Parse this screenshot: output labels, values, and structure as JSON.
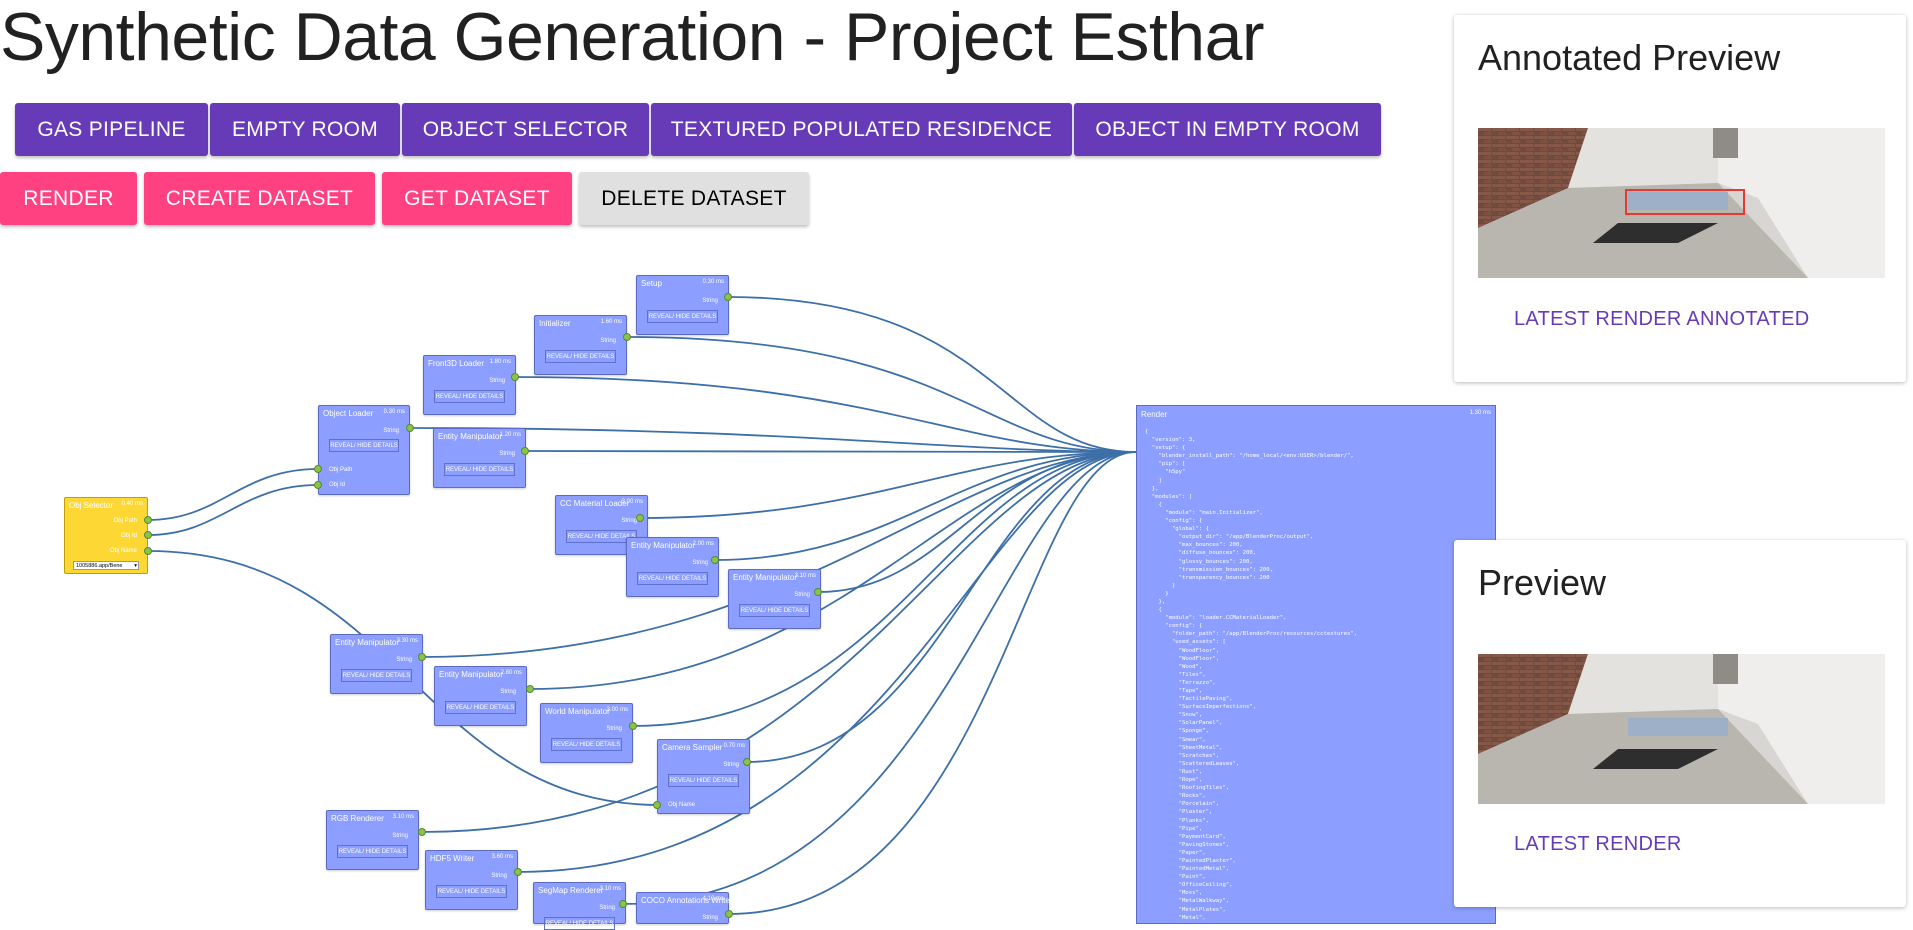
{
  "page_title": "Synthetic Data Generation - Project Esthar",
  "scene_buttons": [
    "GAS PIPELINE",
    "EMPTY ROOM",
    "OBJECT SELECTOR",
    "TEXTURED POPULATED RESIDENCE",
    "OBJECT IN EMPTY ROOM"
  ],
  "action_buttons": {
    "render": "RENDER",
    "create": "CREATE DATASET",
    "get": "GET DATASET",
    "delete": "DELETE DATASET"
  },
  "annotated_card": {
    "title": "Annotated Preview",
    "link": "LATEST RENDER ANNOTATED"
  },
  "preview_card": {
    "title": "Preview",
    "link": "LATEST RENDER"
  },
  "node_button_label": "REVEAL/ HIDE DETAILS",
  "nodes": [
    {
      "title": "Setup",
      "ms": "0.30 ms",
      "out": "String"
    },
    {
      "title": "Initializer",
      "ms": "1.60 ms",
      "out": "String"
    },
    {
      "title": "Front3D Loader",
      "ms": "1.80 ms",
      "out": "String"
    },
    {
      "title": "Object Loader",
      "ms": "0.30 ms",
      "out": "String",
      "in1": "Obj Path",
      "in2": "Obj Id"
    },
    {
      "title": "Entity Manipulator",
      "ms": "1.20 ms",
      "out": "String"
    },
    {
      "title": "CC Material Loader",
      "ms": "3.00 ms",
      "out": "String"
    },
    {
      "title": "Entity Manipulator",
      "ms": "2.00 ms",
      "out": "String"
    },
    {
      "title": "Entity Manipulator",
      "ms": "3.10 ms",
      "out": "String"
    },
    {
      "title": "Entity Manipulator",
      "ms": "3.30 ms",
      "out": "String"
    },
    {
      "title": "Entity Manipulator",
      "ms": "2.80 ms",
      "out": "String"
    },
    {
      "title": "World Manipulator",
      "ms": "3.00 ms",
      "out": "String"
    },
    {
      "title": "Camera Sampler",
      "ms": "0.70 ms",
      "out": "String",
      "in1": "Obj Name"
    },
    {
      "title": "RGB Renderer",
      "ms": "3.10 ms",
      "out": "String"
    },
    {
      "title": "HDF5 Writer",
      "ms": "3.60 ms",
      "out": "String"
    },
    {
      "title": "SegMap Renderer",
      "ms": "3.10 ms",
      "out": "String"
    },
    {
      "title": "COCO Annotations Writer",
      "ms": "4.10 ms",
      "out": "String"
    }
  ],
  "obj_selector": {
    "title": "Obj Selector",
    "ms": "0.40 ms",
    "out1": "Obj Path",
    "out2": "Obj Id",
    "out3": "Obj Name",
    "select_value": "1005886.app/Bene"
  },
  "render_node": {
    "title": "Render",
    "ms": "1.30 ms",
    "json": "{\n  \"version\": 3,\n  \"setup\": {\n    \"blender_install_path\": \"/home_local/<env:USER>/blender/\",\n    \"pip\": [\n      \"h5py\"\n    ]\n  },\n  \"modules\": [\n    {\n      \"module\": \"main.Initializer\",\n      \"config\": {\n        \"global\": {\n          \"output_dir\": \"/app/BlenderProc/output\",\n          \"max_bounces\": 200,\n          \"diffuse_bounces\": 200,\n          \"glossy_bounces\": 200,\n          \"transmission_bounces\": 200,\n          \"transparency_bounces\": 200\n        }\n      }\n    },\n    {\n      \"module\": \"loader.CCMaterialLoader\",\n      \"config\": {\n        \"folder_path\": \"/app/BlenderProc/resources/cctextures\",\n        \"used_assets\": [\n          \"WoodFloor\",\n          \"WoodFloor\",\n          \"Wood\",\n          \"Tiles\",\n          \"Terrazzo\",\n          \"Tape\",\n          \"TactilePaving\",\n          \"SurfaceImperfections\",\n          \"Snow\",\n          \"SolarPanel\",\n          \"Sponge\",\n          \"Smear\",\n          \"SheetMetal\",\n          \"Scratches\",\n          \"ScatteredLeaves\",\n          \"Rust\",\n          \"Rope\",\n          \"RoofingTiles\",\n          \"Rocks\",\n          \"Porcelain\",\n          \"Plaster\",\n          \"Planks\",\n          \"Pipe\",\n          \"PaymentCard\",\n          \"PavingStones\",\n          \"Paper\",\n          \"PaintedPlaster\",\n          \"PaintedMetal\",\n          \"Paint\",\n          \"OfficeCeiling\",\n          \"Moss\",\n          \"MetalWalkway\",\n          \"MetalPlates\",\n          \"Metal\",\n          \"Marble\""
  }
}
